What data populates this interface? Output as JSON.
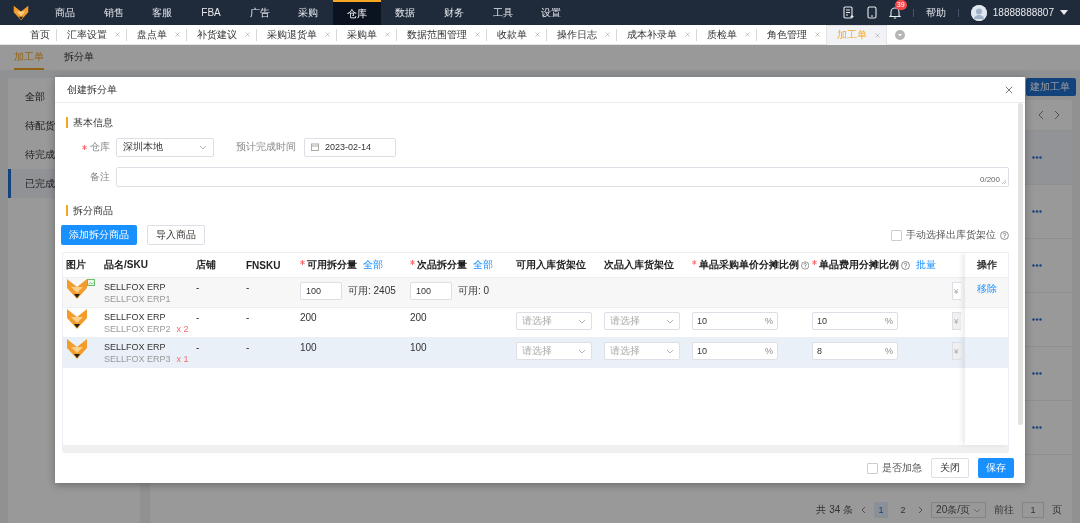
{
  "top_nav": {
    "items": [
      {
        "label": "商品",
        "selected": false
      },
      {
        "label": "销售",
        "selected": false
      },
      {
        "label": "客服",
        "selected": false
      },
      {
        "label": "FBA",
        "selected": false
      },
      {
        "label": "广告",
        "selected": false
      },
      {
        "label": "采购",
        "selected": false
      },
      {
        "label": "仓库",
        "selected": true
      },
      {
        "label": "数据",
        "selected": false
      },
      {
        "label": "财务",
        "selected": false
      },
      {
        "label": "工具",
        "selected": false
      },
      {
        "label": "设置",
        "selected": false
      }
    ],
    "notification_count": "39",
    "help": "帮助",
    "username": "18888888807"
  },
  "page_tabs": [
    {
      "label": "首页",
      "closable": false,
      "selected": false
    },
    {
      "label": "汇率设置",
      "closable": true,
      "selected": false
    },
    {
      "label": "盘点单",
      "closable": true,
      "selected": false
    },
    {
      "label": "补货建议",
      "closable": true,
      "selected": false
    },
    {
      "label": "采购退货单",
      "closable": true,
      "selected": false
    },
    {
      "label": "采购单",
      "closable": true,
      "selected": false
    },
    {
      "label": "数据范围管理",
      "closable": true,
      "selected": false
    },
    {
      "label": "收款单",
      "closable": true,
      "selected": false
    },
    {
      "label": "操作日志",
      "closable": true,
      "selected": false
    },
    {
      "label": "成本补录单",
      "closable": true,
      "selected": false
    },
    {
      "label": "质检单",
      "closable": true,
      "selected": false
    },
    {
      "label": "角色管理",
      "closable": true,
      "selected": false
    },
    {
      "label": "加工单",
      "closable": true,
      "selected": true
    }
  ],
  "sub_tabs": [
    {
      "label": "加工单",
      "selected": true
    },
    {
      "label": "拆分单",
      "selected": false
    }
  ],
  "status_filters": [
    {
      "label": "全部",
      "selected": false
    },
    {
      "label": "待配货",
      "selected": false
    },
    {
      "label": "待完成",
      "selected": false
    },
    {
      "label": "已完成",
      "selected": true
    }
  ],
  "create_button": "建加工单",
  "pagination": {
    "total_prefix": "共",
    "total": "34",
    "total_suffix": "条",
    "pages": [
      {
        "label": "1",
        "selected": true
      },
      {
        "label": "2",
        "selected": false
      }
    ],
    "page_size": "20条/页",
    "goto_label": "前往",
    "goto_value": "1",
    "goto_suffix": "页"
  },
  "dialog": {
    "title": "创建拆分单",
    "basic_section": "基本信息",
    "warehouse": {
      "label": "仓库",
      "required": true,
      "value": "深圳本地"
    },
    "finish_date": {
      "label": "预计完成时间",
      "required": false,
      "value": "2023-02-14"
    },
    "remark": {
      "label": "备注",
      "counter": "0/200"
    },
    "items_section": "拆分商品",
    "add_button": "添加拆分商品",
    "import_button": "导入商品",
    "manual_shelf": {
      "label": "手动选择出库货架位",
      "checked": false
    },
    "table": {
      "columns": [
        {
          "label": "图片",
          "required": false,
          "help": false
        },
        {
          "label": "品名/SKU",
          "required": false,
          "help": false
        },
        {
          "label": "店铺",
          "required": false,
          "help": false
        },
        {
          "label": "FNSKU",
          "required": false,
          "help": false
        },
        {
          "label": "可用拆分量",
          "required": true,
          "help": false,
          "link": "全部"
        },
        {
          "label": "次品拆分量",
          "required": true,
          "help": false,
          "link": "全部"
        },
        {
          "label": "可用入库货架位",
          "required": false,
          "help": false
        },
        {
          "label": "次品入库货架位",
          "required": false,
          "help": false
        },
        {
          "label": "单品采购单价分摊比例",
          "required": true,
          "help": true
        },
        {
          "label": "单品费用分摊比例",
          "required": true,
          "help": true,
          "link": "批量"
        }
      ],
      "action_column": "操作",
      "rows": [
        {
          "kind": "source",
          "highlighted": false,
          "name": "SELLFOX ERP",
          "sku": "SELLFOX ERP1",
          "store": "-",
          "fnsku": "-",
          "good_qty": "100",
          "good_available": "可用: 2405",
          "defect_qty": "100",
          "defect_available": "可用: 0",
          "yen": "¥",
          "action": "移除"
        },
        {
          "kind": "component",
          "highlighted": false,
          "name": "SELLFOX ERP",
          "sku": "SELLFOX ERP2",
          "multiplier": "x 2",
          "store": "-",
          "fnsku": "-",
          "good_qty": "200",
          "defect_qty": "200",
          "good_shelf_placeholder": "请选择",
          "defect_shelf_placeholder": "请选择",
          "price_ratio": "10",
          "price_unit": "%",
          "cost_ratio": "10",
          "cost_unit": "%",
          "yen": "¥"
        },
        {
          "kind": "component",
          "highlighted": true,
          "name": "SELLFOX ERP",
          "sku": "SELLFOX ERP3",
          "multiplier": "x 1",
          "store": "-",
          "fnsku": "-",
          "good_qty": "100",
          "defect_qty": "100",
          "good_shelf_placeholder": "请选择",
          "defect_shelf_placeholder": "请选择",
          "price_ratio": "10",
          "price_unit": "%",
          "cost_ratio": "8",
          "cost_unit": "%",
          "yen": "¥"
        }
      ]
    },
    "urgent": {
      "label": "是否加急",
      "checked": false
    },
    "close_button": "关闭",
    "save_button": "保存"
  }
}
